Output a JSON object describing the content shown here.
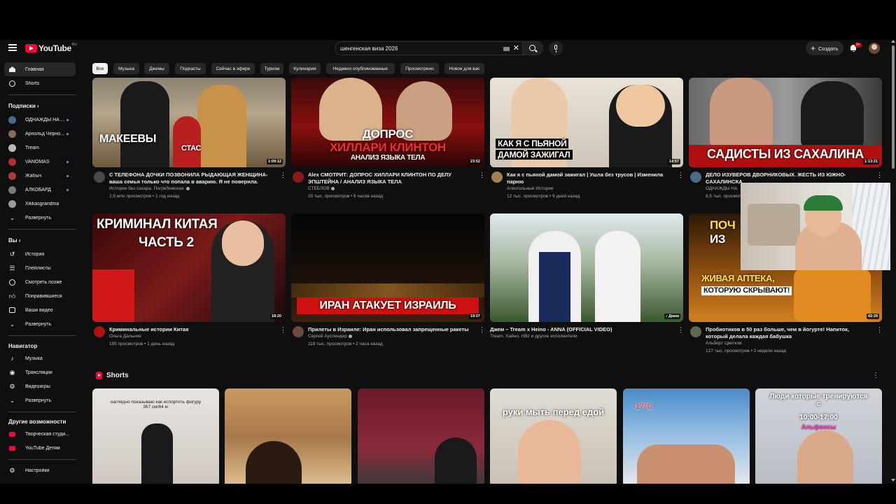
{
  "masthead": {
    "logo_text": "YouTube",
    "logo_region": "RU",
    "search_value": "шенгенская виза 2026",
    "create_label": "Создать",
    "notifications_badge": "9+"
  },
  "sidebar": {
    "main": [
      {
        "label": "Главная",
        "icon": "home-icon"
      },
      {
        "label": "Shorts",
        "icon": "shorts-icon"
      }
    ],
    "subscriptions_heading": "Подписки",
    "subscriptions": [
      {
        "label": "ОДНАЖДЫ НА ...",
        "color": "#4a6a8a",
        "new": true
      },
      {
        "label": "Арнольд Черно...",
        "color": "#8a6a5a",
        "new": true
      },
      {
        "label": "Tream",
        "color": "#bbbbbb",
        "new": false
      },
      {
        "label": "VANOMAS",
        "color": "#b03030",
        "new": true
      },
      {
        "label": "Жабыч",
        "color": "#b03a3a",
        "new": true
      },
      {
        "label": "АЛКОБАРД",
        "color": "#7a7a7a",
        "new": true
      },
      {
        "label": "Xikkasgrandma",
        "color": "#9a9a9a",
        "new": false
      }
    ],
    "subscriptions_expand": "Развернуть",
    "you_heading": "Вы",
    "you": [
      {
        "label": "История",
        "icon": "history-icon"
      },
      {
        "label": "Плейлисты",
        "icon": "playlists-icon"
      },
      {
        "label": "Смотреть позже",
        "icon": "watch-later-icon"
      },
      {
        "label": "Понравившиеся",
        "icon": "like-icon"
      },
      {
        "label": "Ваши видео",
        "icon": "your-videos-icon"
      }
    ],
    "you_expand": "Развернуть",
    "navigator_heading": "Навигатор",
    "navigator": [
      {
        "label": "Музыка",
        "icon": "music-icon"
      },
      {
        "label": "Трансляции",
        "icon": "live-icon"
      },
      {
        "label": "Видеоигры",
        "icon": "gaming-icon"
      }
    ],
    "navigator_expand": "Развернуть",
    "more_heading": "Другие возможности",
    "more": [
      {
        "label": "Творческая студи...",
        "icon": "studio-icon"
      },
      {
        "label": "YouTube Детям",
        "icon": "kids-icon"
      }
    ],
    "settings": "Настройки"
  },
  "chips": [
    "Все",
    "Музыка",
    "Джемы",
    "Подкасты",
    "Сейчас в эфире",
    "Туризм",
    "Кулинария",
    "Недавно опубликованные",
    "Просмотрено",
    "Новое для вас"
  ],
  "videos": [
    {
      "title": "С ТЕЛЕФОНА ДОЧКИ ПОЗВОНИЛА РЫДАЮЩАЯ ЖЕНЩИНА- ваша семья только что попала в аварию. Я не поверила.",
      "channel": "Истории без сахара. Погребижская.",
      "verified": true,
      "stats": "2,9 млн просмотров • 1 год назад",
      "duration": "1:09:12",
      "overlay": [
        "МАКЕЕВЫ",
        "СТАС"
      ]
    },
    {
      "title": "Alex СМОТРИТ: ДОПРОС ХИЛЛАРИ КЛИНТОН ПО ДЕЛУ ЭПШТЕЙНА / АНАЛИЗ ЯЗЫКА ТЕЛА",
      "channel": "СТЕБЛОВ",
      "verified": true,
      "stats": "20 тыс. просмотров • 6 часов назад",
      "duration": "23:52",
      "overlay": [
        "ДОПРОС",
        "ХИЛЛАРИ КЛИНТОН",
        "АНАЛИЗ ЯЗЫКА ТЕЛА"
      ]
    },
    {
      "title": "Как я с пьяной дамой зажигал | Ушла без трусов | Изменила парню",
      "channel": "Алкогольные Истории",
      "verified": false,
      "stats": "12 тыс. просмотров • 9 дней назад",
      "duration": "14:57",
      "overlay": [
        "КАК Я С ПЬЯНОЙ",
        "ДАМОЙ ЗАЖИГАЛ"
      ]
    },
    {
      "title": "ДЕЛО ИЗУВЕРОВ ДВОРНИКОВЫХ. ЖЕСТЬ ИЗ ЮЖНО-САХАЛИНСКА",
      "channel": "ОДНАЖДЫ НА",
      "verified": false,
      "stats": "8,5 тыс. просмотров",
      "duration": "1:13:21",
      "overlay": [
        "САДИСТЫ ИЗ САХАЛИНА"
      ]
    },
    {
      "title": "Криминальные истории Китая",
      "channel": "Ольга Дальняя",
      "verified": false,
      "stats": "195 просмотров • 1 день назад",
      "duration": "18:20",
      "overlay": [
        "КРИМИНАЛ КИТАЯ",
        "ЧАСТЬ 2"
      ]
    },
    {
      "title": "Прилеты в Израиле: Иран использовал запрещенные ракеты",
      "channel": "Сергей Ауслендер",
      "verified": true,
      "stats": "118 тыс. просмотров • 2 часа назад",
      "duration": "19:07",
      "overlay": [
        "ИРАН АТАКУЕТ ИЗРАИЛЬ"
      ]
    },
    {
      "title": "Джем – Tream x Heino - ANNA (OFFICIAL VIDEO)",
      "channel": "Tream, Хайно, HBz и другие исполнители",
      "verified": false,
      "stats": "",
      "duration": "Джем",
      "overlay": []
    },
    {
      "title": "Пробиотиков в 50 раз больше, чем в йогурте! Напиток, который делала каждая бабушка",
      "channel": "Альберт Цветков",
      "verified": false,
      "stats": "127 тыс. просмотров • 2 недели назад",
      "duration": "42:29",
      "overlay": [
        "ПОЧ",
        "ИЗ",
        "ЖИВАЯ АПТЕКА,",
        "КОТОРУЮ СКРЫВАЮТ!"
      ]
    }
  ],
  "shorts": {
    "heading": "Shorts",
    "items": [
      {
        "caption": "наглядно показываю как испортить фигуру 367 см/64 кг"
      },
      {
        "caption": ""
      },
      {
        "caption": ""
      },
      {
        "caption": "руки мыть перед едой"
      },
      {
        "caption": "-17°C"
      },
      {
        "caption": "Люди которые тренируются с",
        "caption2": "10:00-17:00",
        "caption3": "Альфонсы"
      }
    ]
  },
  "colors": {
    "background": "#0f0f0f",
    "accent": "#ff0033",
    "chip": "#272727",
    "text_secondary": "#aaaaaa"
  }
}
